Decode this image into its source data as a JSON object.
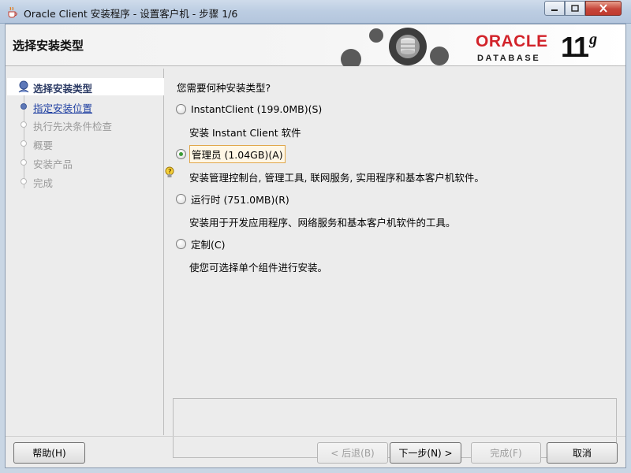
{
  "window": {
    "title": "Oracle Client 安装程序 - 设置客户机 - 步骤 1/6"
  },
  "banner": {
    "title": "选择安装类型",
    "logo_oracle": "ORACLE",
    "logo_database": "DATABASE",
    "logo_version": "11",
    "logo_version_suffix": "g"
  },
  "steps": [
    {
      "label": "选择安装类型",
      "state": "current"
    },
    {
      "label": "指定安装位置",
      "state": "next"
    },
    {
      "label": "执行先决条件检查",
      "state": "disabled"
    },
    {
      "label": "概要",
      "state": "disabled"
    },
    {
      "label": "安装产品",
      "state": "disabled"
    },
    {
      "label": "完成",
      "state": "disabled"
    }
  ],
  "main": {
    "question": "您需要何种安装类型?",
    "options": [
      {
        "label": "InstantClient (199.0MB)(S)",
        "description": "安装 Instant Client 软件",
        "selected": false
      },
      {
        "label": "管理员 (1.04GB)(A)",
        "description": "安装管理控制台, 管理工具, 联网服务, 实用程序和基本客户机软件。",
        "selected": true
      },
      {
        "label": "运行时 (751.0MB)(R)",
        "description": "安装用于开发应用程序、网络服务和基本客户机软件的工具。",
        "selected": false
      },
      {
        "label": "定制(C)",
        "description": "使您可选择单个组件进行安装。",
        "selected": false
      }
    ]
  },
  "buttons": {
    "help": "帮助(H)",
    "back": "< 后退(B)",
    "next": "下一步(N) >",
    "finish": "完成(F)",
    "cancel": "取消"
  },
  "colors": {
    "accent_oracle_red": "#d2232a",
    "selected_radio": "#3b9b36",
    "link_blue": "#1c3da0"
  }
}
